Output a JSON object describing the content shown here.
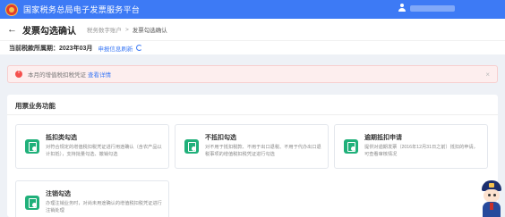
{
  "app": {
    "title": "国家税务总局电子发票服务平台",
    "user_icon": "user-icon"
  },
  "header": {
    "back_icon": "←",
    "page_title": "发票勾选确认",
    "breadcrumbs": [
      "税务数字账户",
      "发票勾选确认"
    ],
    "crumb_separator": ">"
  },
  "period": {
    "label": "当前税款所属期：",
    "value": "2023年03月",
    "link": "申报信息刷新",
    "refresh_icon": "refresh-icon"
  },
  "alert": {
    "text": "本月的增值税扣税凭证",
    "link": "查看详情",
    "close": "×",
    "icon": "alert-icon",
    "color": "#f5504d"
  },
  "section": {
    "title": "用票业务功能",
    "cards": [
      {
        "title": "抵扣类勾选",
        "desc": "对符合规定的增值税扣税凭证进行用途确认（含农产品以计扣抵），支持批量勾选、撤销勾选"
      },
      {
        "title": "不抵扣勾选",
        "desc": "对不用于抵扣税款、不用于出口退税、不用于代办出口退税事项的增值税扣税凭证进行勾选"
      },
      {
        "title": "逾期抵扣申请",
        "desc": "提供对逾期发票（2016年12月31日之前）抵扣的申请，可查看审核情况"
      },
      {
        "title": "注销勾选",
        "desc": "办理注销业务时，对尚未用途确认的增值税扣税凭证进行注销处理"
      }
    ]
  },
  "colors": {
    "brand": "#3d7af5",
    "accent_green": "#20b07a"
  }
}
